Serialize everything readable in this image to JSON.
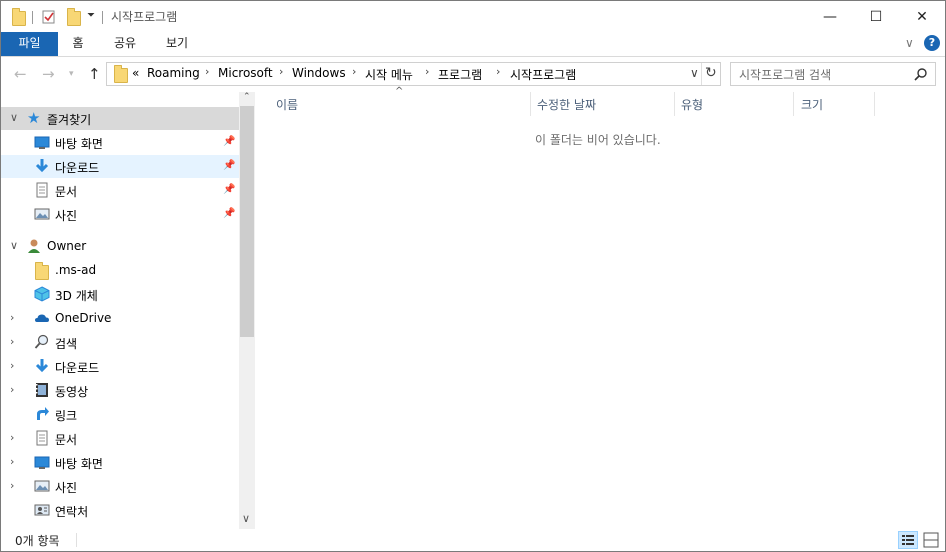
{
  "window": {
    "title": "시작프로그램",
    "controls": {
      "minimize": "—",
      "maximize": "☐",
      "close": "✕"
    }
  },
  "ribbon": {
    "tabs": [
      {
        "label": "파일",
        "active": true
      },
      {
        "label": "홈"
      },
      {
        "label": "공유"
      },
      {
        "label": "보기"
      }
    ]
  },
  "address": {
    "overflow": "«",
    "crumbs": [
      "Roaming",
      "Microsoft",
      "Windows",
      "시작 메뉴",
      "프로그램",
      "시작프로그램"
    ]
  },
  "search": {
    "placeholder": "시작프로그램 검색"
  },
  "nav": {
    "quick_access": {
      "label": "즐겨찾기",
      "items": [
        {
          "label": "바탕 화면",
          "icon": "desktop-icon",
          "pinned": true
        },
        {
          "label": "다운로드",
          "icon": "download-icon",
          "pinned": true
        },
        {
          "label": "문서",
          "icon": "document-icon",
          "pinned": true
        },
        {
          "label": "사진",
          "icon": "pictures-icon",
          "pinned": true
        }
      ]
    },
    "user": {
      "label": "Owner",
      "items": [
        {
          "label": ".ms-ad",
          "icon": "folder-icon"
        },
        {
          "label": "3D 개체",
          "icon": "3d-objects-icon"
        },
        {
          "label": "OneDrive",
          "icon": "onedrive-icon"
        },
        {
          "label": "검색",
          "icon": "search-icon"
        },
        {
          "label": "다운로드",
          "icon": "download-icon"
        },
        {
          "label": "동영상",
          "icon": "video-icon"
        },
        {
          "label": "링크",
          "icon": "link-icon"
        },
        {
          "label": "문서",
          "icon": "document-icon"
        },
        {
          "label": "바탕 화면",
          "icon": "desktop-icon"
        },
        {
          "label": "사진",
          "icon": "pictures-icon"
        },
        {
          "label": "연락처",
          "icon": "contacts-icon"
        }
      ]
    }
  },
  "columns": [
    {
      "label": "이름"
    },
    {
      "label": "수정한 날짜"
    },
    {
      "label": "유형"
    },
    {
      "label": "크기"
    }
  ],
  "content": {
    "empty_message": "이 폴더는 비어 있습니다."
  },
  "status": {
    "count": "0개 항목"
  },
  "colors": {
    "accent": "#1a66b3",
    "folder": "#f8d775",
    "selected": "#d9d9d9",
    "hover": "#e5f3ff"
  }
}
